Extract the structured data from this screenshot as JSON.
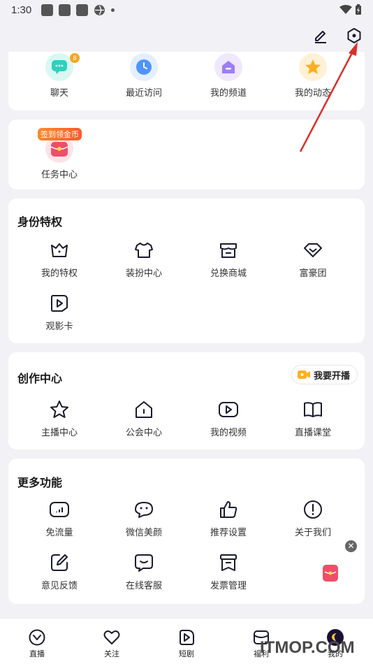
{
  "status_bar": {
    "time": "1:30"
  },
  "quick_access": [
    {
      "label": "聊天",
      "icon": "chat-icon",
      "badge": "8",
      "color": "#3bd6c6"
    },
    {
      "label": "最近访问",
      "icon": "clock-icon",
      "color": "#5aa3ff"
    },
    {
      "label": "我的频道",
      "icon": "channel-icon",
      "color": "#a48bf5"
    },
    {
      "label": "我的动态",
      "icon": "star-icon",
      "color": "#ffb020"
    }
  ],
  "task_center": {
    "tag": "签到领金币",
    "label": "任务中心"
  },
  "identity": {
    "title": "身份特权",
    "items": [
      {
        "label": "我的特权",
        "icon": "crown-icon"
      },
      {
        "label": "装扮中心",
        "icon": "shirt-icon"
      },
      {
        "label": "兑换商城",
        "icon": "shop-icon"
      },
      {
        "label": "富豪团",
        "icon": "diamond-icon"
      },
      {
        "label": "观影卡",
        "icon": "play-card-icon"
      }
    ]
  },
  "creation": {
    "title": "创作中心",
    "live_button": "我要开播",
    "items": [
      {
        "label": "主播中心",
        "icon": "star-outline-icon"
      },
      {
        "label": "公会中心",
        "icon": "house-icon"
      },
      {
        "label": "我的视频",
        "icon": "video-icon"
      },
      {
        "label": "直播课堂",
        "icon": "book-icon"
      }
    ]
  },
  "more": {
    "title": "更多功能",
    "items": [
      {
        "label": "免流量",
        "icon": "data-icon"
      },
      {
        "label": "微信美颜",
        "icon": "beauty-icon"
      },
      {
        "label": "推荐设置",
        "icon": "thumb-up-icon"
      },
      {
        "label": "关于我们",
        "icon": "info-icon"
      },
      {
        "label": "意见反馈",
        "icon": "feedback-icon"
      },
      {
        "label": "在线客服",
        "icon": "service-icon"
      },
      {
        "label": "发票管理",
        "icon": "invoice-icon"
      }
    ]
  },
  "tabs": [
    {
      "label": "直播",
      "icon": "live-tab-icon"
    },
    {
      "label": "关注",
      "icon": "heart-icon"
    },
    {
      "label": "短剧",
      "icon": "play-tab-icon"
    },
    {
      "label": "福利",
      "icon": "gift-tab-icon"
    },
    {
      "label": "我的",
      "icon": "avatar-icon"
    }
  ],
  "watermark": "ITMOP.COM",
  "colors": {
    "accent": "#1a1a2e",
    "arrow": "#d9302c",
    "badge": "#f5a623"
  }
}
